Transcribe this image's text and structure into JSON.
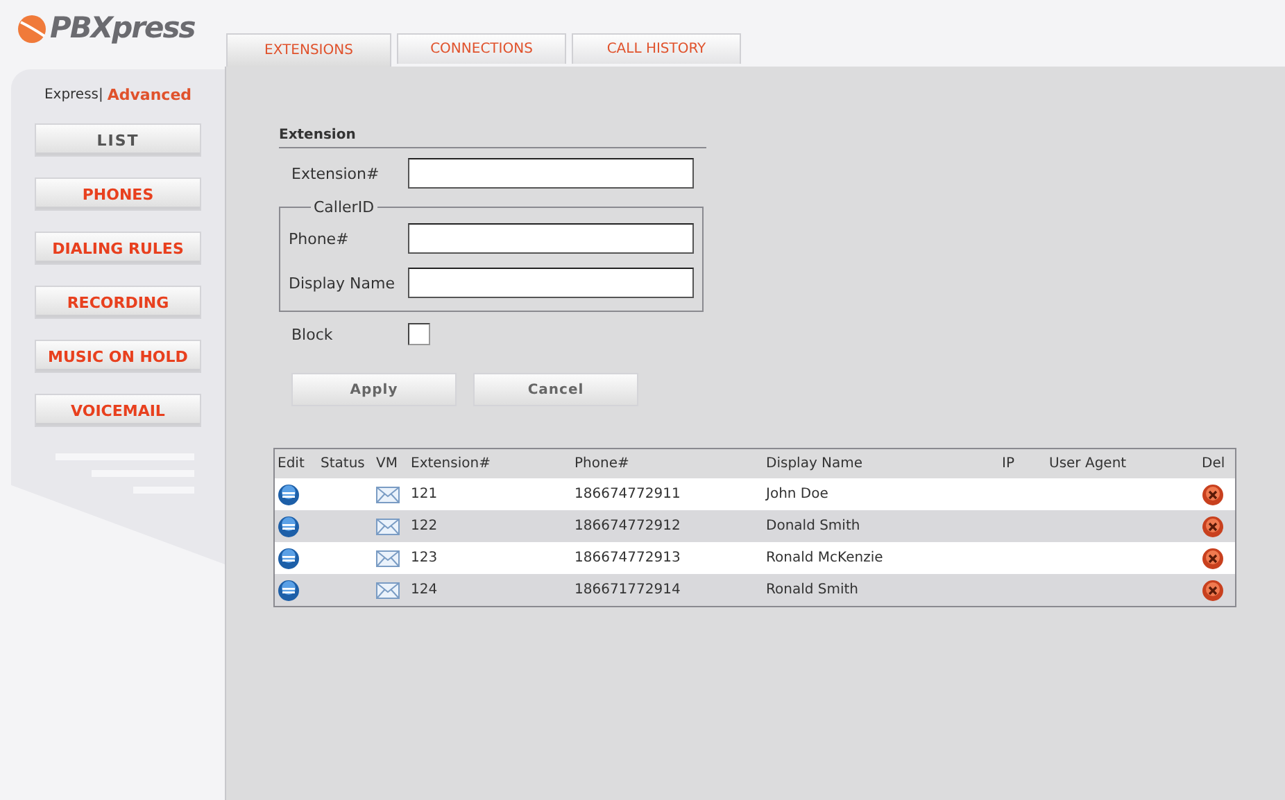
{
  "logo": {
    "text": "PBXpress"
  },
  "tabs": [
    {
      "label": "EXTENSIONS",
      "selected": true
    },
    {
      "label": "CONNECTIONS",
      "selected": false
    },
    {
      "label": "CALL HISTORY",
      "selected": false
    }
  ],
  "modes": [
    {
      "label": "Express|",
      "selected": false
    },
    {
      "label": "Advanced",
      "selected": true
    }
  ],
  "sidebar": {
    "items": [
      {
        "label": "LIST",
        "selected": true
      },
      {
        "label": "PHONES",
        "selected": false
      },
      {
        "label": "DIALING RULES",
        "selected": false
      },
      {
        "label": "RECORDING",
        "selected": false
      },
      {
        "label": "MUSIC ON HOLD",
        "selected": false
      },
      {
        "label": "VOICEMAIL",
        "selected": false
      }
    ]
  },
  "form": {
    "title": "Extension",
    "extension_label": "Extension#",
    "caller_id": {
      "legend": "CallerID",
      "phone_label": "Phone#",
      "display_name_label": "Display Name"
    },
    "block": {
      "label": "Block",
      "checked": false
    },
    "buttons": [
      "Apply",
      "Cancel"
    ]
  },
  "table": {
    "columns": [
      "Edit",
      "Status",
      "VM",
      "Extension#",
      "Phone#",
      "Display Name",
      "IP",
      "User Agent",
      "Del"
    ],
    "rows": [
      {
        "extension": "121",
        "phone": "186674772911",
        "display_name": "John Doe"
      },
      {
        "extension": "122",
        "phone": "186674772912",
        "display_name": "Donald Smith"
      },
      {
        "extension": "123",
        "phone": "186674772913",
        "display_name": "Ronald McKenzie"
      },
      {
        "extension": "124",
        "phone": "186671772914",
        "display_name": "Ronald Smith"
      }
    ]
  }
}
